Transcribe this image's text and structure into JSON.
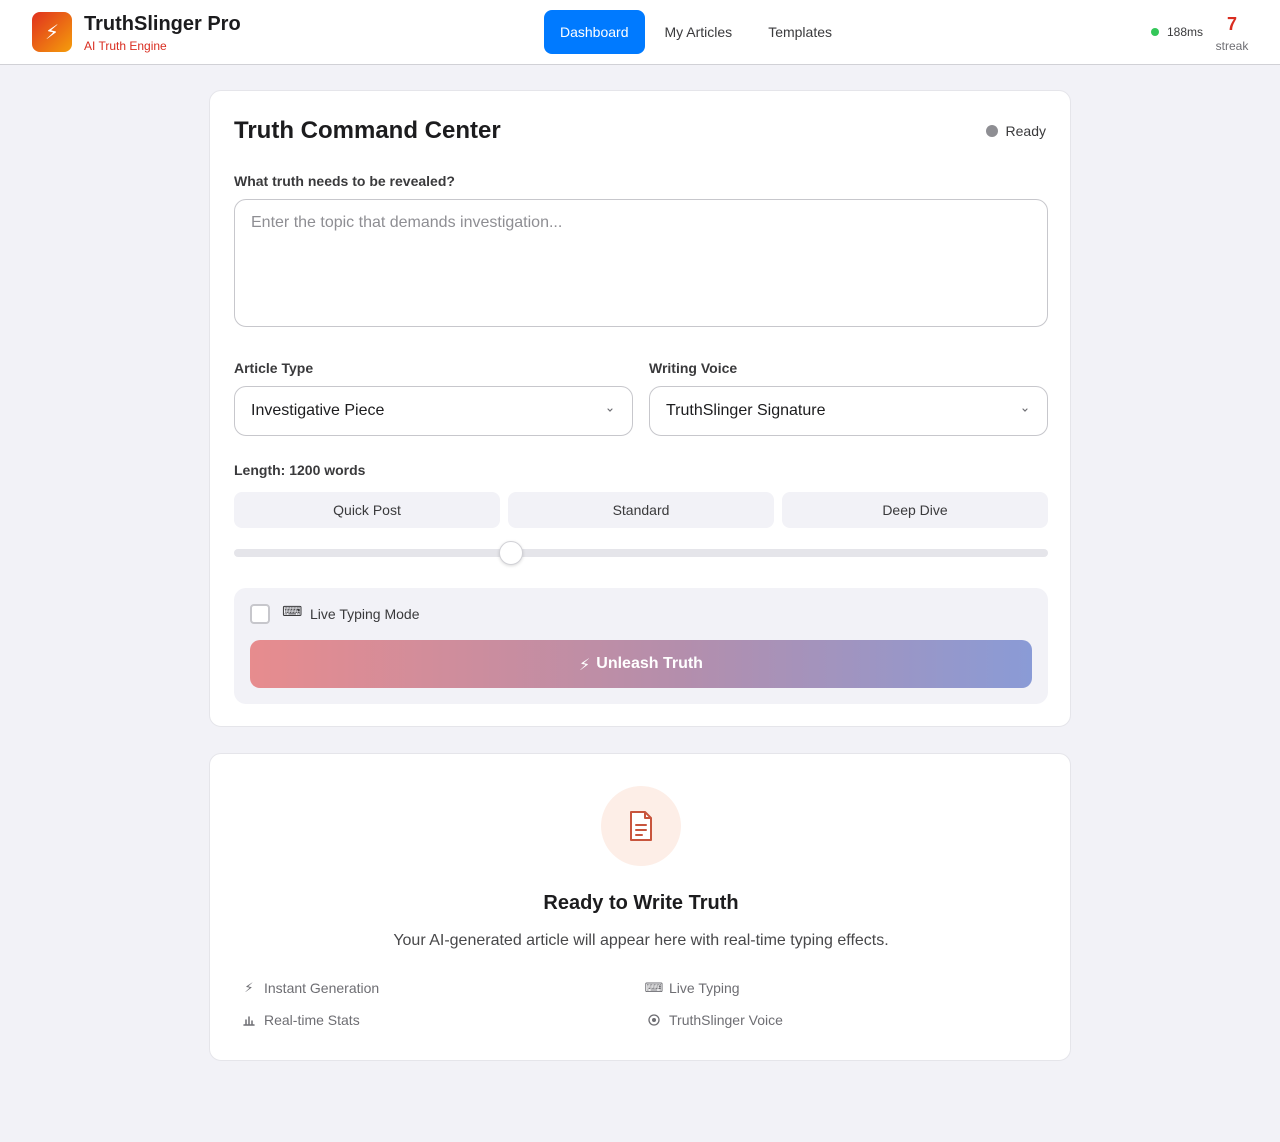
{
  "header": {
    "logo_icon": "lightning-bolt-icon",
    "app_title": "TruthSlinger Pro",
    "app_subtitle": "AI Truth Engine",
    "nav": [
      {
        "label": "Dashboard",
        "active": true
      },
      {
        "label": "My Articles",
        "active": false
      },
      {
        "label": "Templates",
        "active": false
      }
    ],
    "latency": "188ms",
    "streak_count": "7",
    "streak_label": "streak"
  },
  "command_center": {
    "title": "Truth Command Center",
    "status": "Ready",
    "topic_label": "What truth needs to be revealed?",
    "topic_placeholder": "Enter the topic that demands investigation...",
    "topic_value": "",
    "article_type_label": "Article Type",
    "article_type_value": "Investigative Piece",
    "voice_label": "Writing Voice",
    "voice_value": "TruthSlinger Signature",
    "length_label": "Length: 1200 words",
    "length_presets": [
      "Quick Post",
      "Standard",
      "Deep Dive"
    ],
    "length_slider_fraction": 0.34,
    "live_typing_label": "Live Typing Mode",
    "live_typing_checked": false,
    "submit_label": "Unleash Truth"
  },
  "output_placeholder": {
    "icon": "document-icon",
    "title": "Ready to Write Truth",
    "subtitle": "Your AI-generated article will appear here with real-time typing effects.",
    "features": [
      {
        "icon": "lightning-bolt-icon",
        "label": "Instant Generation"
      },
      {
        "icon": "keyboard-icon",
        "label": "Live Typing"
      },
      {
        "icon": "chart-icon",
        "label": "Real-time Stats"
      },
      {
        "icon": "target-icon",
        "label": "TruthSlinger Voice"
      }
    ]
  },
  "colors": {
    "accent": "#007aff",
    "brand_red": "#d92d20",
    "status_green": "#34c759",
    "status_idle": "#8e8e93"
  }
}
